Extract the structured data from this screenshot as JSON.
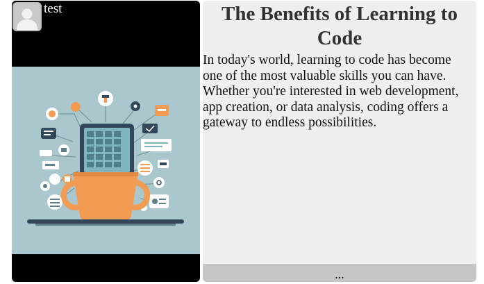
{
  "post": {
    "author": {
      "name": "test",
      "avatar_icon": "default-user-avatar-icon"
    },
    "image": {
      "subject": "laptop-coffee-cup-tech-icons-illustration",
      "colors": {
        "background": "#a9c7cc",
        "cup": "#f29b52",
        "device": "#33475b",
        "screen": "#7fb5bf"
      }
    },
    "title": "The Benefits of Learning to Code",
    "body": "In today's world, learning to code has become one of the most valuable skills you can have. Whether you're interested in web development, app creation, or data analysis, coding offers a gateway to endless possibilities.",
    "more_label": "..."
  }
}
